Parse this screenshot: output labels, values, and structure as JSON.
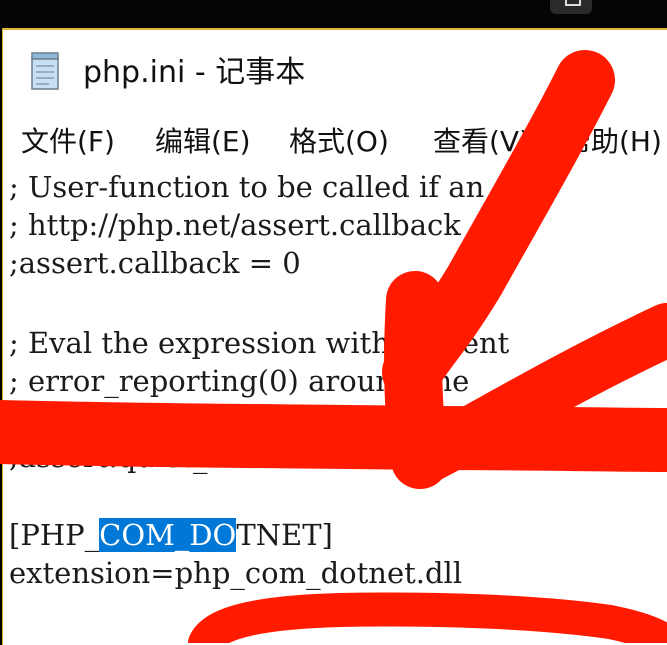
{
  "window": {
    "title": "php.ini - 记事本",
    "icon": "notepad-icon"
  },
  "menu": {
    "items": [
      "文件(F)",
      "编辑(E)",
      "格式(O)",
      "查看(V)",
      "帮助(H)"
    ]
  },
  "editor": {
    "lines": [
      "; User-function to be called if an",
      "; http://php.net/assert.callback",
      ";assert.callback = 0",
      "",
      "; Eval the expression with current",
      "; error_reporting(0) around the",
      "",
      ";assert.quiet_eval = 0",
      "",
      "",
      "extension=php_com_dotnet.dll"
    ],
    "section_header": {
      "before": "[PHP_",
      "selected": "COM_DO",
      "after": "TNET]"
    },
    "selection_color": "#0078d7"
  },
  "annotation": {
    "color": "#ff1a00",
    "icon": "hand-drawn-arrow-annotation"
  }
}
